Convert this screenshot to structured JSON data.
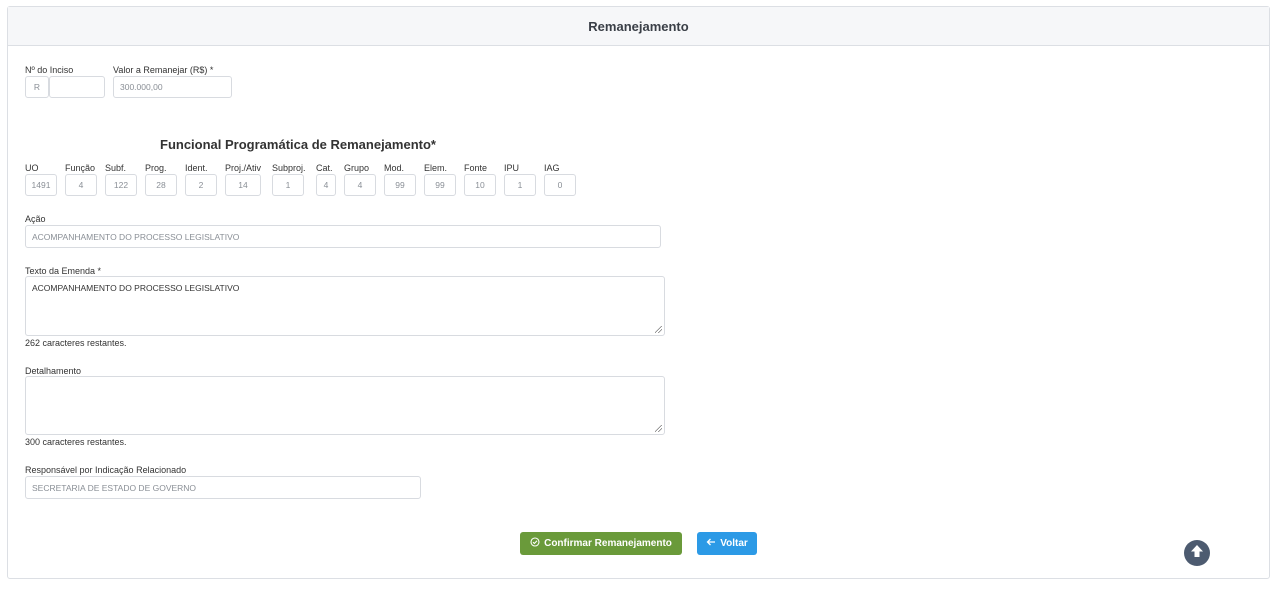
{
  "header": {
    "title": "Remanejamento"
  },
  "inciso": {
    "label": "Nº do Inciso",
    "prefix": "R",
    "value": ""
  },
  "valor": {
    "label": "Valor a Remanejar (R$) *",
    "value": "300.000,00"
  },
  "funcional": {
    "title": "Funcional Programática de Remanejamento*",
    "fields": [
      {
        "label": "UO",
        "value": "1491"
      },
      {
        "label": "Função",
        "value": "4"
      },
      {
        "label": "Subf.",
        "value": "122"
      },
      {
        "label": "Prog.",
        "value": "28"
      },
      {
        "label": "Ident.",
        "value": "2"
      },
      {
        "label": "Proj./Ativ",
        "value": "14"
      },
      {
        "label": "Subproj.",
        "value": "1"
      },
      {
        "label": "Cat.",
        "value": "4"
      },
      {
        "label": "Grupo",
        "value": "4"
      },
      {
        "label": "Mod.",
        "value": "99"
      },
      {
        "label": "Elem.",
        "value": "99"
      },
      {
        "label": "Fonte",
        "value": "10"
      },
      {
        "label": "IPU",
        "value": "1"
      },
      {
        "label": "IAG",
        "value": "0"
      }
    ]
  },
  "acao": {
    "label": "Ação",
    "value": "ACOMPANHAMENTO DO PROCESSO LEGISLATIVO"
  },
  "texto": {
    "label": "Texto da Emenda *",
    "value": "ACOMPANHAMENTO DO PROCESSO LEGISLATIVO",
    "remaining": "262 caracteres restantes."
  },
  "detalhamento": {
    "label": "Detalhamento",
    "value": "",
    "remaining": "300 caracteres restantes."
  },
  "responsavel": {
    "label": "Responsável por Indicação Relacionado",
    "value": "SECRETARIA DE ESTADO DE GOVERNO"
  },
  "buttons": {
    "confirm": "Confirmar Remanejamento",
    "back": "Voltar"
  },
  "icons": {
    "confirm": "check-circle-icon",
    "back": "arrow-left-icon",
    "scroll": "arrow-up-circle-icon"
  },
  "colors": {
    "confirm": "#6a9a3a",
    "back": "#2c9ae6",
    "scroll": "#4d5b70"
  }
}
